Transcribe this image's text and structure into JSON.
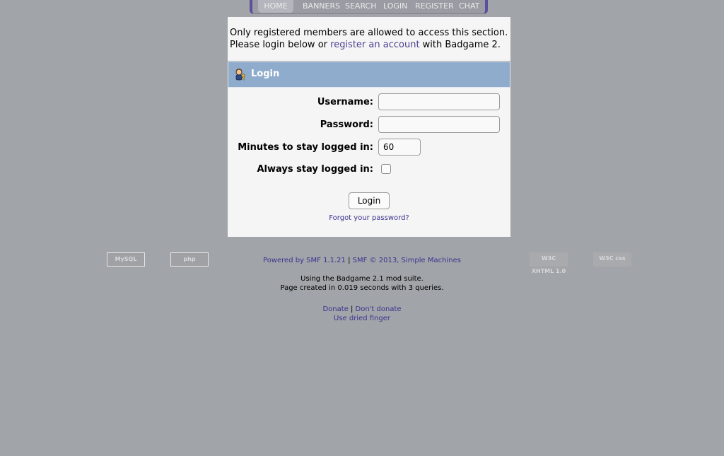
{
  "nav": {
    "items": [
      {
        "label": "HOME",
        "active": true
      },
      {
        "label": "BANNERS"
      },
      {
        "label": "SEARCH"
      },
      {
        "label": "LOGIN"
      },
      {
        "label": "REGISTER"
      },
      {
        "label": "CHAT"
      }
    ]
  },
  "notice": {
    "line1": "Only registered members are allowed to access this section.",
    "line2_prefix": "Please login below or ",
    "register_link": "register an account",
    "line2_suffix": " with Badgame 2."
  },
  "login": {
    "title": "Login",
    "icon": "user-key-icon",
    "username_label": "Username:",
    "username_value": "",
    "password_label": "Password:",
    "password_value": "",
    "minutes_label": "Minutes to stay logged in:",
    "minutes_value": "60",
    "always_label": "Always stay logged in:",
    "always_checked": false,
    "submit_label": "Login",
    "forgot_label": "Forgot your password?"
  },
  "footer": {
    "badges": [
      "MySQL",
      "php",
      "W3C XHTML 1.0",
      "W3C css"
    ],
    "powered": "Powered by SMF 1.1.21",
    "separator": "|",
    "copyright": "SMF © 2013, Simple Machines",
    "mod_suite": "Using the Badgame 2.1 mod suite.",
    "page_created": "Page created in 0.019 seconds with 3 queries.",
    "donate": "Donate",
    "dont_donate": "Don't donate",
    "dried_finger": "Use dried finger"
  },
  "colors": {
    "background": "#a1a4a8",
    "panel_header": "#8faccd",
    "link": "#4c3f91",
    "nav_border": "#5b4fa0"
  }
}
